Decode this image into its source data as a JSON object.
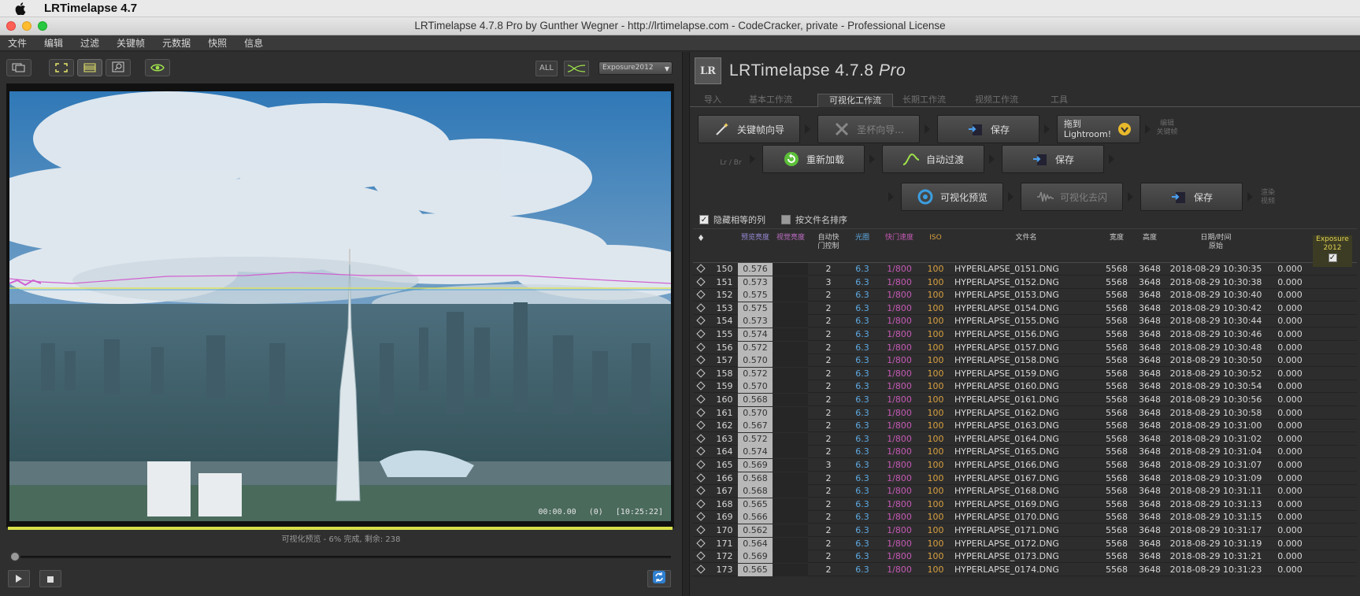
{
  "menubar": {
    "app_name": "LRTimelapse 4.7"
  },
  "window": {
    "title": "LRTimelapse 4.7.8 Pro by Gunther Wegner - http://lrtimelapse.com - CodeCracker, private - Professional License"
  },
  "app_menu": [
    "文件",
    "编辑",
    "过滤",
    "关键帧",
    "元数据",
    "快照",
    "信息"
  ],
  "left_toolbar": {
    "all_label": "ALL",
    "preset_value": "Exposure2012"
  },
  "preview": {
    "timecode_start": "00:00.00",
    "timecode_count": "(0)",
    "timecode_total": "[10:25:22]",
    "status": "可视化预览  -  6% 完成, 剩余: 238"
  },
  "brand": {
    "title_main": "LRTimelapse 4.7.8 ",
    "title_pro": "Pro",
    "logo_text": "LR"
  },
  "tabs": [
    "导入",
    "基本工作流",
    "可视化工作流",
    "长期工作流",
    "视频工作流",
    "工具"
  ],
  "workflow": {
    "row1": {
      "keyframe_wizard": "关键帧向导",
      "holy_grail": "圣杯向导...",
      "save": "保存",
      "drag_lr_line1": "拖到",
      "drag_lr_line2": "Lightroom!",
      "side_line1": "编辑",
      "side_line2": "关键帧"
    },
    "row2": {
      "lr_br": "Lr / Br",
      "reload": "重新加载",
      "auto_transition": "自动过渡",
      "save": "保存"
    },
    "row3": {
      "visual_preview": "可视化预览",
      "visual_deflicker": "可视化去闪",
      "save": "保存",
      "side_line1": "渲染",
      "side_line2": "视频"
    }
  },
  "options": {
    "hide_equal": "隐藏相等的列",
    "sort_by_name": "按文件名排序"
  },
  "table": {
    "headers": {
      "keyframe": "♦",
      "preview_lum": "预览亮度",
      "visual_lum": "视觉亮度",
      "auto_line1": "自动快",
      "auto_line2": "门控制",
      "aperture": "光圈",
      "shutter": "快门速度",
      "iso": "ISO",
      "filename": "文件名",
      "width": "宽度",
      "height": "高度",
      "datetime_line1": "日期/时间",
      "datetime_line2": "原始",
      "exposure_line1": "Exposure",
      "exposure_line2": "2012"
    },
    "rows": [
      {
        "n": "150",
        "pv": "0.576",
        "auto": "2",
        "ap": "6.3",
        "sh": "1/800",
        "iso": "100",
        "file": "HYPERLAPSE_0151.DNG",
        "w": "5568",
        "h": "3648",
        "dt": "2018-08-29 10:30:35",
        "exp": "0.000"
      },
      {
        "n": "151",
        "pv": "0.573",
        "auto": "3",
        "ap": "6.3",
        "sh": "1/800",
        "iso": "100",
        "file": "HYPERLAPSE_0152.DNG",
        "w": "5568",
        "h": "3648",
        "dt": "2018-08-29 10:30:38",
        "exp": "0.000"
      },
      {
        "n": "152",
        "pv": "0.575",
        "auto": "2",
        "ap": "6.3",
        "sh": "1/800",
        "iso": "100",
        "file": "HYPERLAPSE_0153.DNG",
        "w": "5568",
        "h": "3648",
        "dt": "2018-08-29 10:30:40",
        "exp": "0.000"
      },
      {
        "n": "153",
        "pv": "0.575",
        "auto": "2",
        "ap": "6.3",
        "sh": "1/800",
        "iso": "100",
        "file": "HYPERLAPSE_0154.DNG",
        "w": "5568",
        "h": "3648",
        "dt": "2018-08-29 10:30:42",
        "exp": "0.000"
      },
      {
        "n": "154",
        "pv": "0.573",
        "auto": "2",
        "ap": "6.3",
        "sh": "1/800",
        "iso": "100",
        "file": "HYPERLAPSE_0155.DNG",
        "w": "5568",
        "h": "3648",
        "dt": "2018-08-29 10:30:44",
        "exp": "0.000"
      },
      {
        "n": "155",
        "pv": "0.574",
        "auto": "2",
        "ap": "6.3",
        "sh": "1/800",
        "iso": "100",
        "file": "HYPERLAPSE_0156.DNG",
        "w": "5568",
        "h": "3648",
        "dt": "2018-08-29 10:30:46",
        "exp": "0.000"
      },
      {
        "n": "156",
        "pv": "0.572",
        "auto": "2",
        "ap": "6.3",
        "sh": "1/800",
        "iso": "100",
        "file": "HYPERLAPSE_0157.DNG",
        "w": "5568",
        "h": "3648",
        "dt": "2018-08-29 10:30:48",
        "exp": "0.000"
      },
      {
        "n": "157",
        "pv": "0.570",
        "auto": "2",
        "ap": "6.3",
        "sh": "1/800",
        "iso": "100",
        "file": "HYPERLAPSE_0158.DNG",
        "w": "5568",
        "h": "3648",
        "dt": "2018-08-29 10:30:50",
        "exp": "0.000"
      },
      {
        "n": "158",
        "pv": "0.572",
        "auto": "2",
        "ap": "6.3",
        "sh": "1/800",
        "iso": "100",
        "file": "HYPERLAPSE_0159.DNG",
        "w": "5568",
        "h": "3648",
        "dt": "2018-08-29 10:30:52",
        "exp": "0.000"
      },
      {
        "n": "159",
        "pv": "0.570",
        "auto": "2",
        "ap": "6.3",
        "sh": "1/800",
        "iso": "100",
        "file": "HYPERLAPSE_0160.DNG",
        "w": "5568",
        "h": "3648",
        "dt": "2018-08-29 10:30:54",
        "exp": "0.000"
      },
      {
        "n": "160",
        "pv": "0.568",
        "auto": "2",
        "ap": "6.3",
        "sh": "1/800",
        "iso": "100",
        "file": "HYPERLAPSE_0161.DNG",
        "w": "5568",
        "h": "3648",
        "dt": "2018-08-29 10:30:56",
        "exp": "0.000"
      },
      {
        "n": "161",
        "pv": "0.570",
        "auto": "2",
        "ap": "6.3",
        "sh": "1/800",
        "iso": "100",
        "file": "HYPERLAPSE_0162.DNG",
        "w": "5568",
        "h": "3648",
        "dt": "2018-08-29 10:30:58",
        "exp": "0.000"
      },
      {
        "n": "162",
        "pv": "0.567",
        "auto": "2",
        "ap": "6.3",
        "sh": "1/800",
        "iso": "100",
        "file": "HYPERLAPSE_0163.DNG",
        "w": "5568",
        "h": "3648",
        "dt": "2018-08-29 10:31:00",
        "exp": "0.000"
      },
      {
        "n": "163",
        "pv": "0.572",
        "auto": "2",
        "ap": "6.3",
        "sh": "1/800",
        "iso": "100",
        "file": "HYPERLAPSE_0164.DNG",
        "w": "5568",
        "h": "3648",
        "dt": "2018-08-29 10:31:02",
        "exp": "0.000"
      },
      {
        "n": "164",
        "pv": "0.574",
        "auto": "2",
        "ap": "6.3",
        "sh": "1/800",
        "iso": "100",
        "file": "HYPERLAPSE_0165.DNG",
        "w": "5568",
        "h": "3648",
        "dt": "2018-08-29 10:31:04",
        "exp": "0.000"
      },
      {
        "n": "165",
        "pv": "0.569",
        "auto": "3",
        "ap": "6.3",
        "sh": "1/800",
        "iso": "100",
        "file": "HYPERLAPSE_0166.DNG",
        "w": "5568",
        "h": "3648",
        "dt": "2018-08-29 10:31:07",
        "exp": "0.000"
      },
      {
        "n": "166",
        "pv": "0.568",
        "auto": "2",
        "ap": "6.3",
        "sh": "1/800",
        "iso": "100",
        "file": "HYPERLAPSE_0167.DNG",
        "w": "5568",
        "h": "3648",
        "dt": "2018-08-29 10:31:09",
        "exp": "0.000"
      },
      {
        "n": "167",
        "pv": "0.568",
        "auto": "2",
        "ap": "6.3",
        "sh": "1/800",
        "iso": "100",
        "file": "HYPERLAPSE_0168.DNG",
        "w": "5568",
        "h": "3648",
        "dt": "2018-08-29 10:31:11",
        "exp": "0.000"
      },
      {
        "n": "168",
        "pv": "0.565",
        "auto": "2",
        "ap": "6.3",
        "sh": "1/800",
        "iso": "100",
        "file": "HYPERLAPSE_0169.DNG",
        "w": "5568",
        "h": "3648",
        "dt": "2018-08-29 10:31:13",
        "exp": "0.000"
      },
      {
        "n": "169",
        "pv": "0.566",
        "auto": "2",
        "ap": "6.3",
        "sh": "1/800",
        "iso": "100",
        "file": "HYPERLAPSE_0170.DNG",
        "w": "5568",
        "h": "3648",
        "dt": "2018-08-29 10:31:15",
        "exp": "0.000"
      },
      {
        "n": "170",
        "pv": "0.562",
        "auto": "2",
        "ap": "6.3",
        "sh": "1/800",
        "iso": "100",
        "file": "HYPERLAPSE_0171.DNG",
        "w": "5568",
        "h": "3648",
        "dt": "2018-08-29 10:31:17",
        "exp": "0.000"
      },
      {
        "n": "171",
        "pv": "0.564",
        "auto": "2",
        "ap": "6.3",
        "sh": "1/800",
        "iso": "100",
        "file": "HYPERLAPSE_0172.DNG",
        "w": "5568",
        "h": "3648",
        "dt": "2018-08-29 10:31:19",
        "exp": "0.000"
      },
      {
        "n": "172",
        "pv": "0.569",
        "auto": "2",
        "ap": "6.3",
        "sh": "1/800",
        "iso": "100",
        "file": "HYPERLAPSE_0173.DNG",
        "w": "5568",
        "h": "3648",
        "dt": "2018-08-29 10:31:21",
        "exp": "0.000"
      },
      {
        "n": "173",
        "pv": "0.565",
        "auto": "2",
        "ap": "6.3",
        "sh": "1/800",
        "iso": "100",
        "file": "HYPERLAPSE_0174.DNG",
        "w": "5568",
        "h": "3648",
        "dt": "2018-08-29 10:31:23",
        "exp": "0.000"
      }
    ]
  },
  "colors": {
    "aperture": "#5ea8e0",
    "shutter": "#c55ab5",
    "iso": "#d8a040",
    "exposure_header": "#e0d050",
    "progress": "#d7e04a",
    "preview_lum_header": "#9a8ad8",
    "visual_lum_header": "#c070c8"
  }
}
